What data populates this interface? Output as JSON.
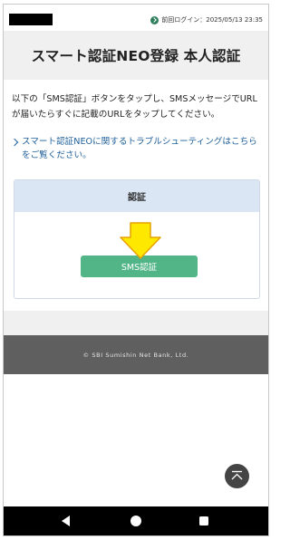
{
  "status_bar": {
    "last_login": "前回ログイン：2025/05/13 23:35"
  },
  "header": {
    "title": "スマート認証NEO登録 本人認証"
  },
  "main": {
    "instruction": "以下の「SMS認証」ボタンをタップし、SMSメッセージでURLが届いたらすぐに記載のURLをタップしてください。",
    "trouble_link": "スマート認証NEOに関するトラブルシューティングはこちらをご覧ください。",
    "auth_card": {
      "heading": "認証",
      "sms_button_label": "SMS認証"
    }
  },
  "footer": {
    "copyright": "© SBI Sumishin Net Bank, Ltd."
  },
  "colors": {
    "accent_green": "#52b588",
    "link_blue": "#1e5f9a",
    "arrow_yellow": "#ffe800",
    "footer_gray": "#5f5f5f"
  },
  "icons": {
    "scroll_top": "scroll-to-top-icon",
    "nav_back": "back-triangle-icon",
    "nav_home": "home-circle-icon",
    "nav_recent": "recent-apps-square-icon"
  }
}
